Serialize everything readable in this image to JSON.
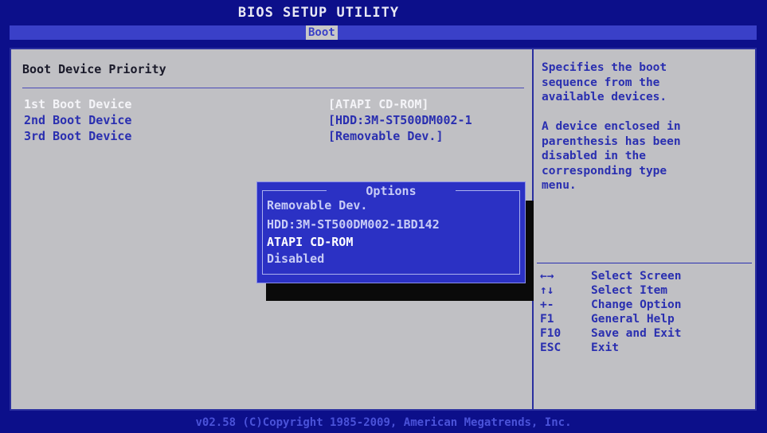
{
  "header": {
    "title": "BIOS SETUP UTILITY",
    "active_tab": "Boot"
  },
  "section": {
    "title": "Boot Device Priority"
  },
  "boot_devices": [
    {
      "label": "1st Boot Device",
      "value": "[ATAPI CD-ROM]",
      "selected": true
    },
    {
      "label": "2nd Boot Device",
      "value": "[HDD:3M-ST500DM002-1",
      "selected": false
    },
    {
      "label": "3rd Boot Device",
      "value": "[Removable Dev.]",
      "selected": false
    }
  ],
  "help": {
    "text": "Specifies the boot\nsequence from the\navailable devices.\n\nA device enclosed in\nparenthesis has been\ndisabled in the\ncorresponding type\nmenu."
  },
  "keys": [
    {
      "key": "←→",
      "desc": "Select Screen"
    },
    {
      "key": "↑↓",
      "desc": "Select Item"
    },
    {
      "key": "+-",
      "desc": "Change Option"
    },
    {
      "key": "F1",
      "desc": "General Help"
    },
    {
      "key": "F10",
      "desc": "Save and Exit"
    },
    {
      "key": "ESC",
      "desc": "Exit"
    }
  ],
  "options_popup": {
    "title": "Options",
    "items": [
      {
        "label": "Removable Dev.",
        "selected": false
      },
      {
        "label": "HDD:3M-ST500DM002-1BD142",
        "selected": false
      },
      {
        "label": "ATAPI CD-ROM",
        "selected": true
      },
      {
        "label": "Disabled",
        "selected": false
      }
    ]
  },
  "footer": {
    "text": "v02.58 (C)Copyright 1985-2009, American Megatrends, Inc."
  }
}
